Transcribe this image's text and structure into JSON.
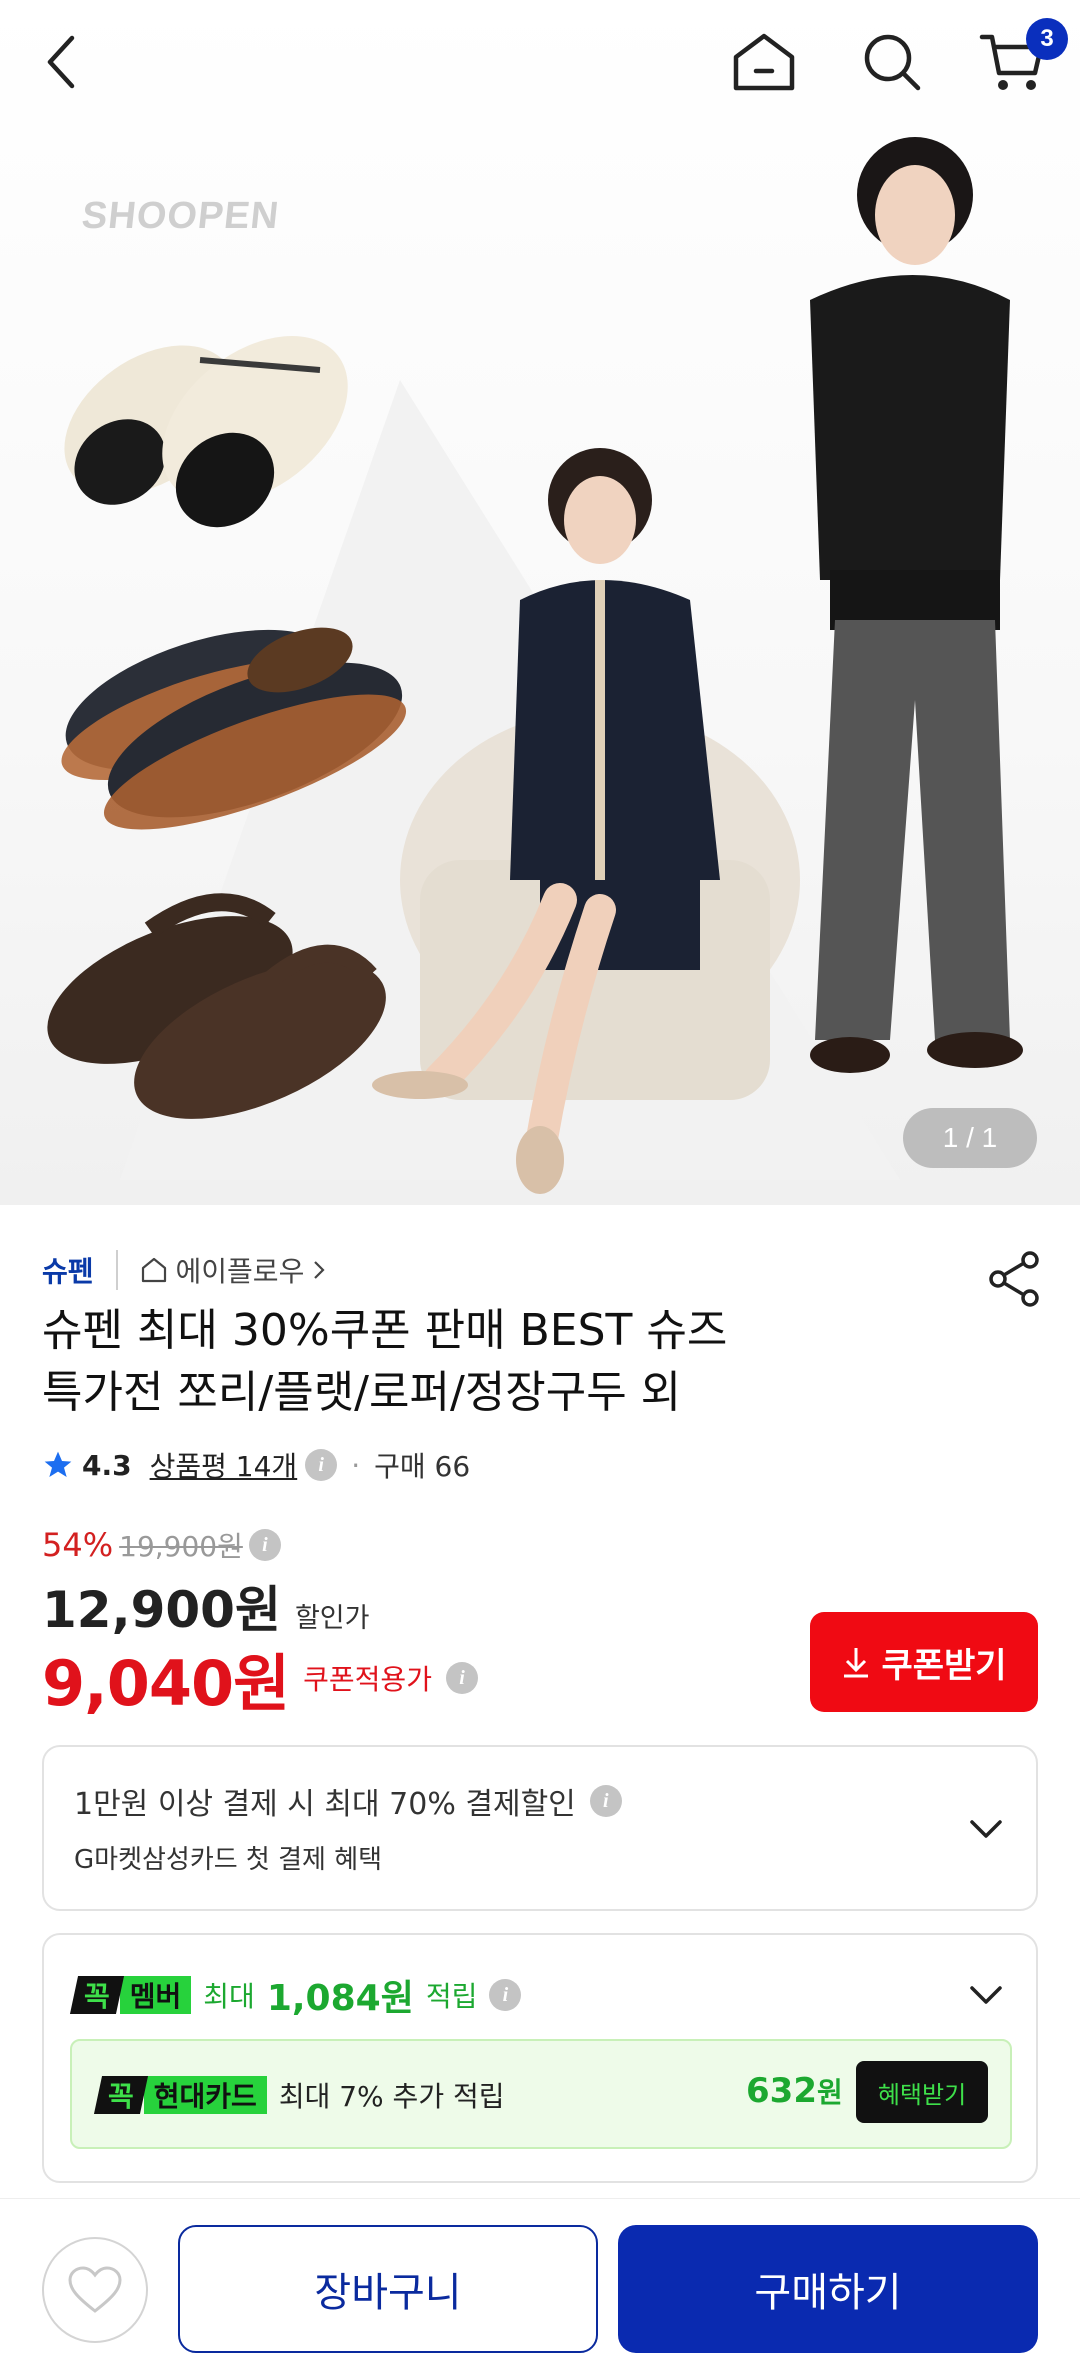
{
  "header": {
    "cart_count": "3"
  },
  "hero": {
    "watermark": "SHOOPEN",
    "indicator": "1 / 1"
  },
  "product": {
    "brand": "슈펜",
    "shop": "에이플로우",
    "title_line1": "슈펜 최대 30%쿠폰 판매 BEST 슈즈",
    "title_line2": "특가전 쪼리/플랫/로퍼/정장구두 외",
    "rating": "4.3",
    "review_label": "상품평 14개",
    "purchase_label": "구매 66"
  },
  "pricing": {
    "discount_rate": "54%",
    "original_price": "19,900원",
    "sale_price": "12,900원",
    "sale_label": "할인가",
    "coupon_price": "9,040원",
    "coupon_label": "쿠폰적용가",
    "coupon_button": "쿠폰받기"
  },
  "payment_benefit": {
    "line1": "1만원 이상 결제 시 최대  70% 결제할인",
    "line2": "G마켓삼성카드 첫 결제 혜택"
  },
  "membership": {
    "badge_k": "꼭",
    "badge_name": "멤버",
    "max_label": "최대",
    "points": "1,084원",
    "earn_label": "적립",
    "card_badge_k": "꼭",
    "card_badge_name": "현대카드",
    "card_text": "최대 7% 추가 적립",
    "card_points": "632",
    "card_points_unit": "원",
    "card_button": "혜택받기"
  },
  "bottom": {
    "cart_button": "장바구니",
    "buy_button": "구매하기"
  },
  "colors": {
    "brand_blue": "#0a2ab0",
    "price_red": "#e0121b",
    "member_green": "#1ca830"
  }
}
